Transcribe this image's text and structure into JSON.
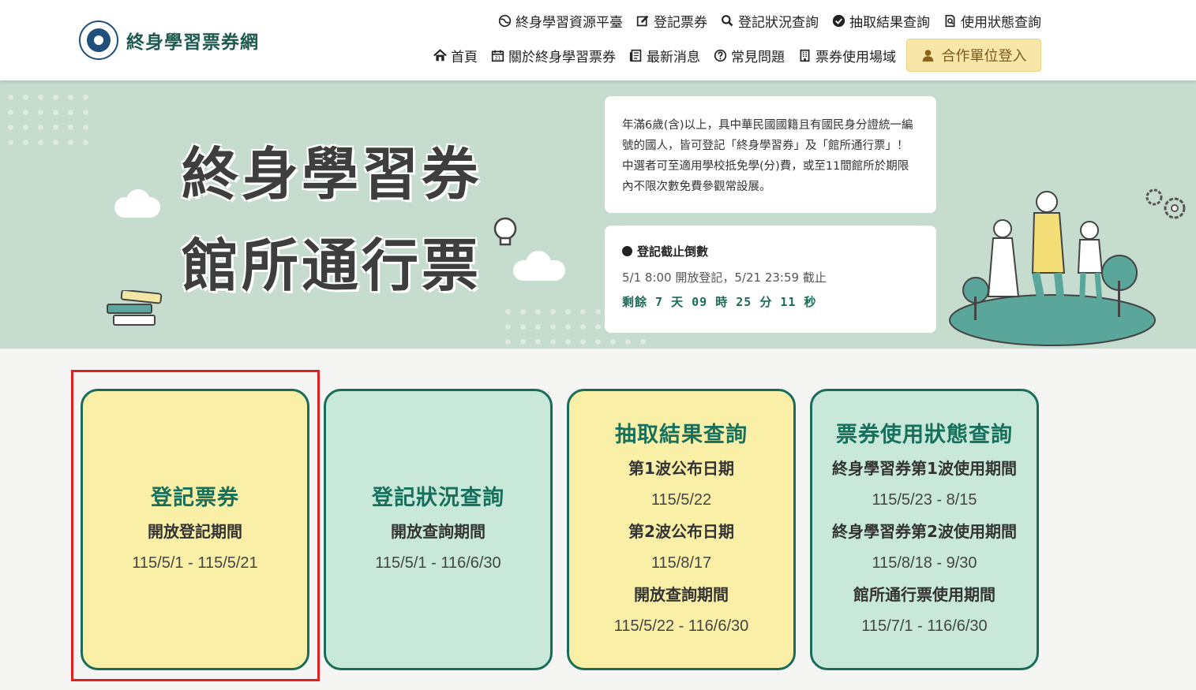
{
  "header": {
    "logo_text": "終身學習票券網",
    "nav_top": [
      {
        "label": "終身學習資源平臺",
        "icon": "globe-icon"
      },
      {
        "label": "登記票券",
        "icon": "edit-icon"
      },
      {
        "label": "登記狀況查詢",
        "icon": "search-icon"
      },
      {
        "label": "抽取結果查詢",
        "icon": "check-circle-icon"
      },
      {
        "label": "使用狀態查詢",
        "icon": "doc-search-icon"
      }
    ],
    "nav_bottom": [
      {
        "label": "首頁",
        "icon": "home-icon"
      },
      {
        "label": "關於終身學習票券",
        "icon": "calendar-icon"
      },
      {
        "label": "最新消息",
        "icon": "news-icon"
      },
      {
        "label": "常見問題",
        "icon": "question-icon"
      },
      {
        "label": "票券使用場域",
        "icon": "building-icon"
      }
    ],
    "login_label": "合作單位登入"
  },
  "banner": {
    "title_line1": "終身學習券",
    "title_line2": "館所通行票",
    "info_text": "年滿6歲(含)以上，具中華民國國籍且有國民身分證統一編號的國人，皆可登記「終身學習券」及「館所通行票」！中選者可至適用學校抵免學(分)費，或至11間館所於期限內不限次數免費參觀常設展。",
    "countdown_title": "登記截止倒數",
    "countdown_sub": "5/1 8:00 開放登記，5/21 23:59 截止",
    "countdown_remain": "剩餘 7 天 09 時 25 分 11 秒"
  },
  "cards": [
    {
      "title": "登記票券",
      "lines": [
        {
          "bold": "開放登記期間"
        },
        {
          "date": "115/5/1 - 115/5/21"
        }
      ]
    },
    {
      "title": "登記狀況查詢",
      "lines": [
        {
          "bold": "開放查詢期間"
        },
        {
          "date": "115/5/1 - 116/6/30"
        }
      ]
    },
    {
      "title": "抽取結果查詢",
      "lines": [
        {
          "bold": "第1波公布日期"
        },
        {
          "date": "115/5/22"
        },
        {
          "bold": "第2波公布日期"
        },
        {
          "date": "115/8/17"
        },
        {
          "bold": "開放查詢期間"
        },
        {
          "date": "115/5/22 - 116/6/30"
        }
      ]
    },
    {
      "title": "票券使用狀態查詢",
      "lines": [
        {
          "bold": "終身學習券第1波使用期間"
        },
        {
          "date": "115/5/23 - 8/15"
        },
        {
          "bold": "終身學習券第2波使用期間"
        },
        {
          "date": "115/8/18 - 9/30"
        },
        {
          "bold": "館所通行票使用期間"
        },
        {
          "date": "115/7/1 - 116/6/30"
        }
      ]
    }
  ]
}
